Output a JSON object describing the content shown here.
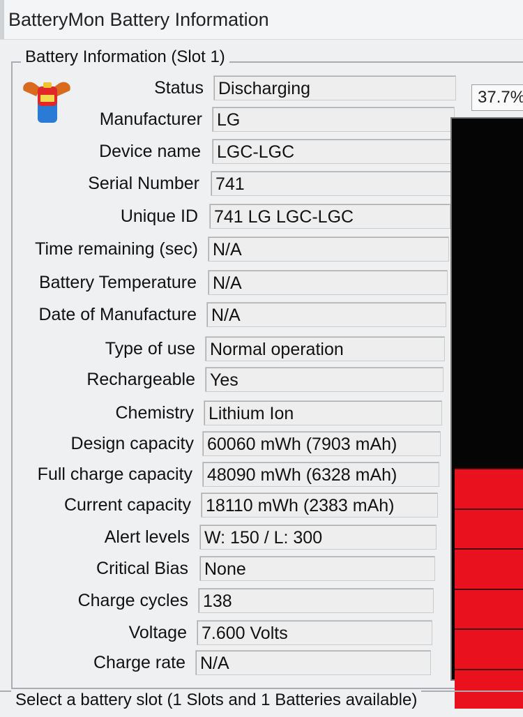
{
  "window": {
    "title": "BatteryMon Battery Information"
  },
  "group": {
    "legend": "Battery Information (Slot 1)"
  },
  "fields": [
    {
      "label": "Status",
      "value": "Discharging"
    },
    {
      "label": "Manufacturer",
      "value": "LG"
    },
    {
      "label": "Device name",
      "value": "LGC-LGC"
    },
    {
      "label": "Serial Number",
      "value": "741"
    },
    {
      "label": "Unique ID",
      "value": "741 LG LGC-LGC"
    },
    {
      "label": "Time remaining (sec)",
      "value": "N/A"
    },
    {
      "label": "Battery Temperature",
      "value": "N/A"
    },
    {
      "label": "Date of Manufacture",
      "value": "N/A"
    },
    {
      "label": "Type of use",
      "value": "Normal operation"
    },
    {
      "label": "Rechargeable",
      "value": "Yes"
    },
    {
      "label": "Chemistry",
      "value": "Lithium Ion"
    },
    {
      "label": "Design capacity",
      "value": "60060 mWh (7903 mAh)"
    },
    {
      "label": "Full charge capacity",
      "value": "48090 mWh (6328 mAh)"
    },
    {
      "label": "Current capacity",
      "value": "18110 mWh (2383 mAh)"
    },
    {
      "label": "Alert levels",
      "value": "W: 150 / L: 300"
    },
    {
      "label": "Critical Bias",
      "value": "None"
    },
    {
      "label": "Charge cycles",
      "value": "138"
    },
    {
      "label": "Voltage",
      "value": "7.600 Volts"
    },
    {
      "label": "Charge rate",
      "value": "N/A"
    }
  ],
  "meter": {
    "percent_text": "37.7%",
    "level": 0.377,
    "fill_color": "#e8111d",
    "empty_color": "#050505"
  },
  "icon": {
    "name": "battery-app-icon"
  },
  "bottom": {
    "legend": "Select a battery slot (1 Slots and 1 Batteries available)"
  }
}
